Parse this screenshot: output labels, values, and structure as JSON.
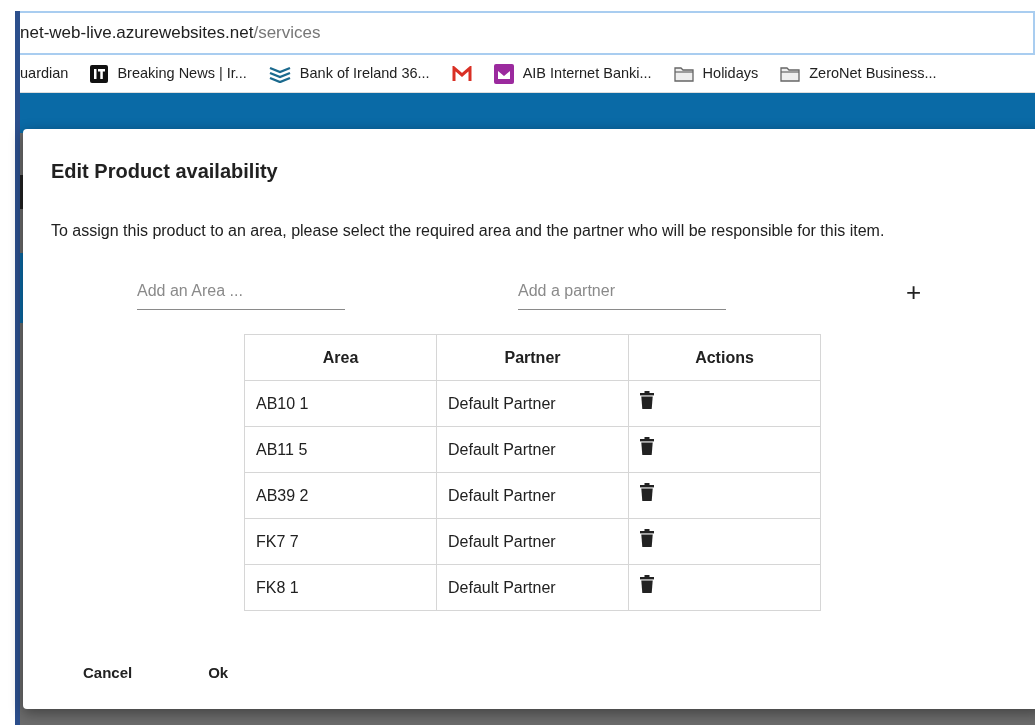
{
  "browser": {
    "url_host": "net-web-live.azurewebsites.net",
    "url_path": "/services",
    "bookmarks": [
      {
        "kind": "plain",
        "label": "uardian"
      },
      {
        "kind": "it",
        "label": "Breaking News | Ir..."
      },
      {
        "kind": "layers",
        "label": "Bank of Ireland 36..."
      },
      {
        "kind": "mail"
      },
      {
        "kind": "purple",
        "label": "AIB Internet Banki..."
      },
      {
        "kind": "folder",
        "label": "Holidays"
      },
      {
        "kind": "folder",
        "label": "ZeroNet Business..."
      }
    ]
  },
  "dialog": {
    "title": "Edit Product availability",
    "description": "To assign this product to an area, please select the required area and the partner who will be responsible for this item.",
    "fields": [
      {
        "placeholder": "Add an Area ..."
      },
      {
        "placeholder": "Add a partner"
      }
    ],
    "add_button": "+",
    "table": {
      "columns": [
        "Area",
        "Partner",
        "Actions"
      ],
      "rows": [
        {
          "area": "AB10 1",
          "partner": "Default Partner"
        },
        {
          "area": "AB11 5",
          "partner": "Default Partner"
        },
        {
          "area": "AB39 2",
          "partner": "Default Partner"
        },
        {
          "area": "FK7 7",
          "partner": "Default Partner"
        },
        {
          "area": "FK8 1",
          "partner": "Default Partner"
        }
      ]
    },
    "buttons": [
      "Cancel",
      "Ok"
    ]
  }
}
